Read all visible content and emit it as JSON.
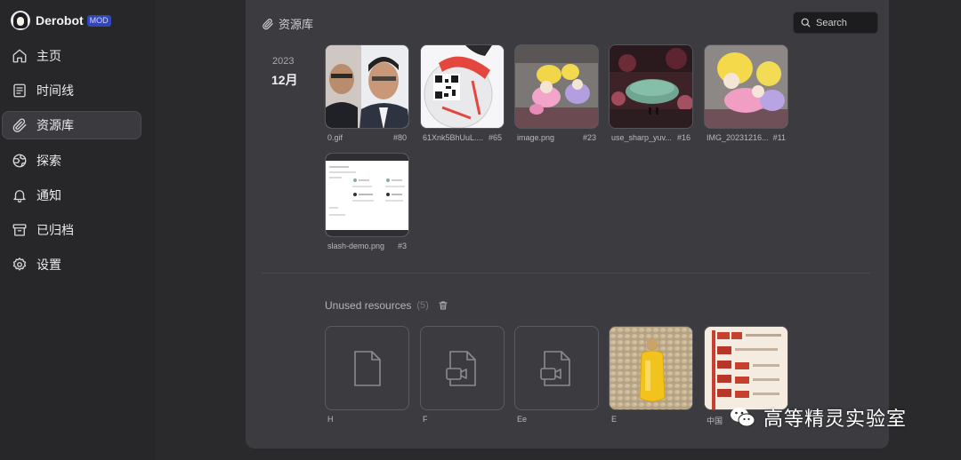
{
  "brand": {
    "name": "Derobot",
    "badge": "MOD"
  },
  "sidebar": {
    "items": [
      {
        "label": "主页",
        "icon": "home-icon"
      },
      {
        "label": "时间线",
        "icon": "timeline-icon"
      },
      {
        "label": "资源库",
        "icon": "paperclip-icon",
        "active": true
      },
      {
        "label": "探索",
        "icon": "globe-icon"
      },
      {
        "label": "通知",
        "icon": "bell-icon"
      },
      {
        "label": "已归档",
        "icon": "archive-icon"
      },
      {
        "label": "设置",
        "icon": "gear-icon"
      }
    ]
  },
  "header": {
    "title": "资源库",
    "search_placeholder": "Search"
  },
  "group": {
    "year": "2023",
    "month": "12月"
  },
  "resources": [
    {
      "name": "0.gif",
      "id": "#80"
    },
    {
      "name": "61Xnk5BhUuL....",
      "id": "#65"
    },
    {
      "name": "image.png",
      "id": "#23"
    },
    {
      "name": "use_sharp_yuv...",
      "id": "#16"
    },
    {
      "name": "IMG_20231216...",
      "id": "#11"
    },
    {
      "name": "slash-demo.png",
      "id": "#3"
    }
  ],
  "unused": {
    "title": "Unused resources",
    "count": "(5)",
    "items": [
      {
        "name": "H",
        "kind": "file-icon"
      },
      {
        "name": "F",
        "kind": "video-file-icon"
      },
      {
        "name": "Ee",
        "kind": "video-file-icon"
      },
      {
        "name": "E",
        "kind": "image"
      },
      {
        "name": "中国",
        "kind": "image"
      }
    ]
  },
  "watermark": {
    "text": "高等精灵实验室"
  }
}
